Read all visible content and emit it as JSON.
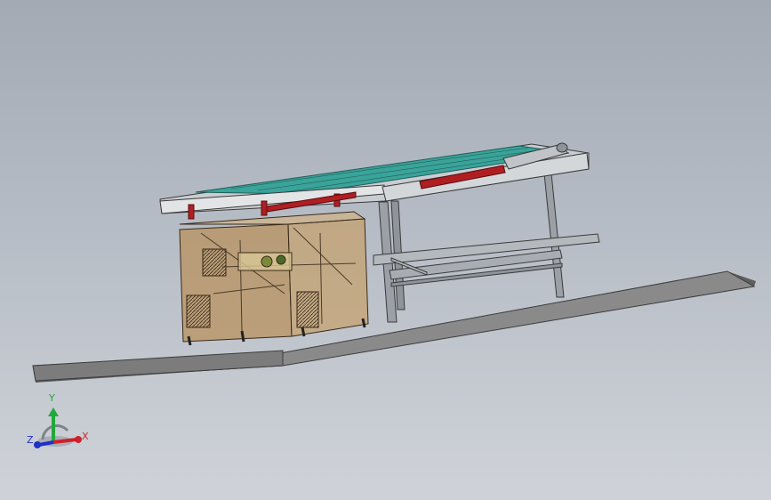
{
  "triad": {
    "x_label": "X",
    "y_label": "Y",
    "z_label": "Z",
    "colors": {
      "x": "#d0202a",
      "y": "#22a83a",
      "z": "#2030c8"
    }
  },
  "colors": {
    "background_top": "#a3aab4",
    "background_bottom": "#cfd3d9",
    "base_plate_top": "#8a8a8a",
    "base_plate_edge": "#5e5e5e",
    "frame_steel": "#9aa0a6",
    "conveyor_belt": "#3aa39a",
    "roller_red": "#b01e22",
    "machine_housing": "#b8925e"
  }
}
